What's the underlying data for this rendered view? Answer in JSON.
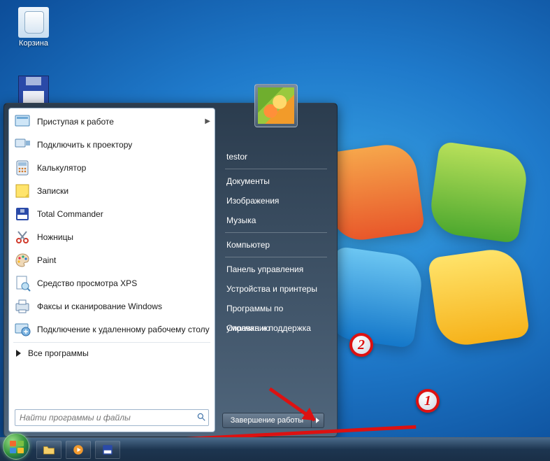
{
  "desktop": {
    "recycle_bin": "Корзина"
  },
  "start_menu": {
    "left_items": [
      {
        "label": "Приступая к работе",
        "has_submenu": true
      },
      {
        "label": "Подключить к проектору",
        "has_submenu": false
      },
      {
        "label": "Калькулятор",
        "has_submenu": false
      },
      {
        "label": "Записки",
        "has_submenu": false
      },
      {
        "label": "Total Commander",
        "has_submenu": false
      },
      {
        "label": "Ножницы",
        "has_submenu": false
      },
      {
        "label": "Paint",
        "has_submenu": false
      },
      {
        "label": "Средство просмотра XPS",
        "has_submenu": false
      },
      {
        "label": "Факсы и сканирование Windows",
        "has_submenu": false
      },
      {
        "label": "Подключение к удаленному рабочему столу",
        "has_submenu": false
      }
    ],
    "all_programs": "Все программы",
    "search_placeholder": "Найти программы и файлы",
    "right_items": [
      "testor",
      "Документы",
      "Изображения",
      "Музыка",
      "Компьютер",
      "Панель управления",
      "Устройства и принтеры",
      "Программы по умолчанию",
      "Справка и поддержка"
    ],
    "shutdown_label": "Завершение работы"
  },
  "annotations": {
    "anno1": "1",
    "anno2": "2"
  }
}
